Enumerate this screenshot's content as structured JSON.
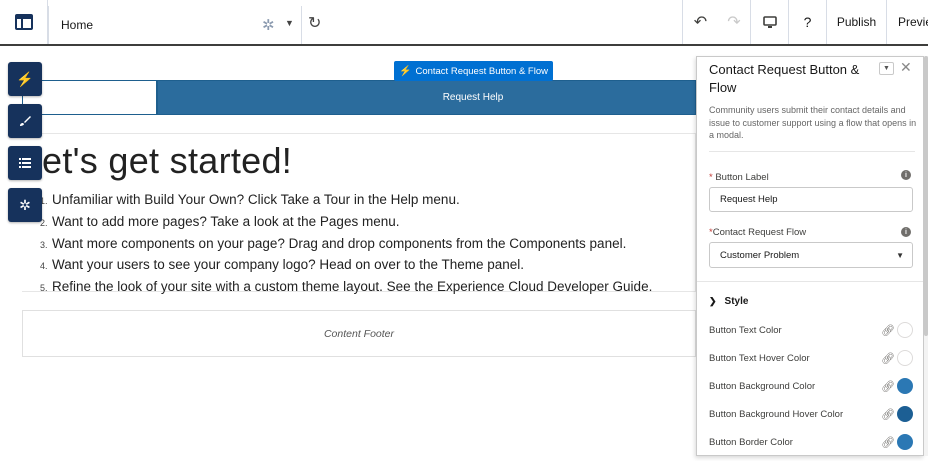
{
  "topbar": {
    "page_select": "Home",
    "publish_label": "Publish",
    "preview_label": "Previe",
    "help_label": "?"
  },
  "component_tag": "Contact Request Button & Flow",
  "canvas": {
    "button_text": "Request Help",
    "hero_title": "et's get started!",
    "tips": [
      {
        "num": "1.",
        "text": "Unfamiliar with Build Your Own? Click Take a Tour in the Help menu."
      },
      {
        "num": "2.",
        "text": "Want to add more pages? Take a look at the Pages menu."
      },
      {
        "num": "3.",
        "text": "Want more components on your page? Drag and drop components from the Components panel."
      },
      {
        "num": "4.",
        "text": "Want your users to see your company logo? Head on over to the Theme panel."
      },
      {
        "num": "5.",
        "text": "Refine the look of your site with a custom theme layout. See the Experience Cloud Developer Guide."
      }
    ],
    "footer_label": "Content Footer"
  },
  "panel": {
    "title": "Contact Request Button & Flow",
    "description": "Community users submit their contact details and issue to customer support using a flow that opens in a modal.",
    "button_label_field": {
      "label": "Button Label",
      "value": "Request Help"
    },
    "flow_field": {
      "label": "Contact Request Flow",
      "value": "Customer Problem"
    },
    "style_section": "Style",
    "color_rows": [
      {
        "label": "Button Text Color",
        "color": "#ffffff"
      },
      {
        "label": "Button Text Hover Color",
        "color": "#ffffff"
      },
      {
        "label": "Button Background Color",
        "color": "#2b78b4"
      },
      {
        "label": "Button Background Hover Color",
        "color": "#1c5f94"
      },
      {
        "label": "Button Border Color",
        "color": "#2b78b4"
      }
    ]
  },
  "icons": {
    "app_menu": "layout-icon",
    "gear": "gear-icon",
    "refresh": "refresh-icon",
    "undo": "undo-icon",
    "redo": "redo-icon",
    "device": "desktop-icon",
    "lightning": "lightning-icon",
    "brush": "brush-icon",
    "list": "list-icon",
    "settings": "settings-icon"
  },
  "colors": {
    "accent": "#0070d2",
    "nav_dark": "#16325c",
    "button_blue": "#2b6c9d"
  }
}
